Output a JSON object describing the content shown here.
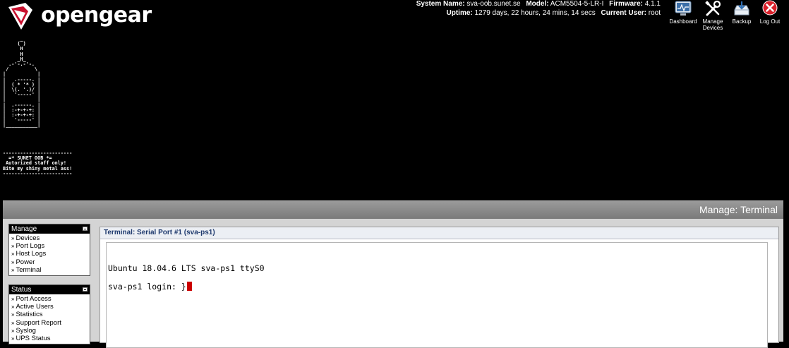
{
  "brand": {
    "name": "opengear"
  },
  "system": {
    "name_label": "System Name:",
    "name_value": "sva-oob.sunet.se",
    "model_label": "Model:",
    "model_value": "ACM5504-5-LR-I",
    "firmware_label": "Firmware:",
    "firmware_value": "4.1.1",
    "uptime_label": "Uptime:",
    "uptime_value": "1279 days, 22 hours, 24 mins, 14 secs",
    "user_label": "Current User:",
    "user_value": "root"
  },
  "toolbar": [
    {
      "label": "Dashboard",
      "icon": "dashboard-icon"
    },
    {
      "label": "Manage Devices",
      "icon": "tools-icon"
    },
    {
      "label": "Backup",
      "icon": "backup-icon"
    },
    {
      "label": "Log Out",
      "icon": "close-icon"
    }
  ],
  "banner": {
    "art": "      _\n     ( )\n      H\n      H\n     _H_\n  .-'-.-'-.\n /         \\\n|           |\n|   .-----. |\n|  ( * '* ) |\n|  \\(. '.)/ |\n|   '-----' |\n|           |\n|  .------. |\n|  :-+-+-+: |\n|  :-+-+-+: |\n|   '-----' |\n|___________|",
    "lines": [
      "------------------------",
      "  =* SUNET OOB *=",
      " Autorized staff only!",
      "Bite my shiny metal ass!",
      "------------------------"
    ]
  },
  "page": {
    "title": "Manage: Terminal"
  },
  "manage": {
    "heading": "Manage",
    "items": [
      "Devices",
      "Port Logs",
      "Host Logs",
      "Power",
      "Terminal"
    ]
  },
  "status": {
    "heading": "Status",
    "items": [
      "Port Access",
      "Active Users",
      "Statistics",
      "Support Report",
      "Syslog",
      "UPS Status"
    ]
  },
  "terminal": {
    "title": "Terminal: Serial Port #1 (sva-ps1)",
    "line1": "Ubuntu 18.04.6 LTS sva-ps1 ttyS0",
    "line2": "sva-ps1 login: }"
  },
  "colors": {
    "header_bg": "#000000",
    "panel_bg": "#d4d4d4",
    "terminal_title": "#1f3a6e",
    "cursor": "#cc0000"
  }
}
